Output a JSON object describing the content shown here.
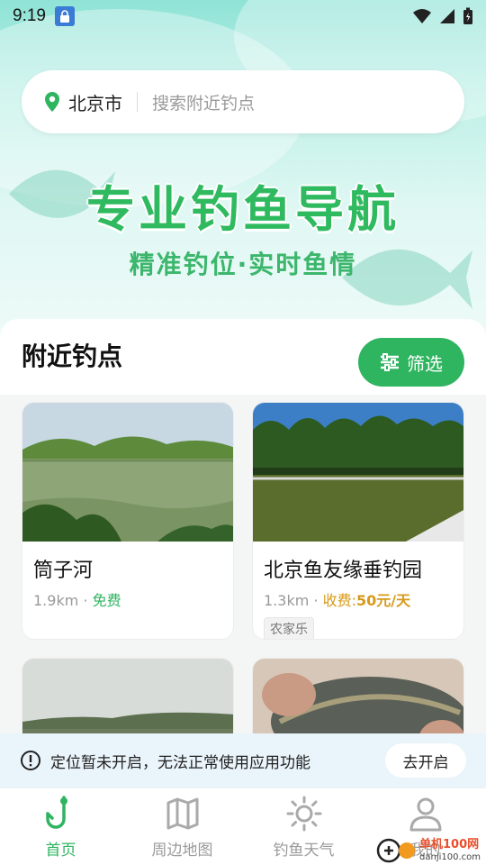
{
  "status": {
    "time": "9:19"
  },
  "search": {
    "city": "北京市",
    "placeholder": "搜索附近钓点"
  },
  "banner": {
    "headline": "专业钓鱼导航",
    "subline": "精准钓位·实时鱼情"
  },
  "section": {
    "title": "附近钓点",
    "filter_label": "筛选"
  },
  "spots": [
    {
      "name": "筒子河",
      "distance": "1.9km",
      "price": "免费",
      "tag": ""
    },
    {
      "name": "北京鱼友缘垂钓园",
      "distance": "1.3km",
      "price_prefix": "收费:",
      "price_value": "50元/天",
      "tag": "农家乐"
    },
    {
      "name": "",
      "distance": "",
      "price": ""
    },
    {
      "name": "",
      "distance": "",
      "price": ""
    }
  ],
  "notice": {
    "text": "定位暂未开启，无法正常使用应用功能",
    "button": "去开启"
  },
  "tabs": [
    {
      "label": "首页",
      "icon": "fishing-hook-icon",
      "active": true
    },
    {
      "label": "周边地图",
      "icon": "map-icon",
      "active": false
    },
    {
      "label": "钓鱼天气",
      "icon": "sun-icon",
      "active": false
    },
    {
      "label": "我的",
      "icon": "user-icon",
      "active": false
    }
  ],
  "watermark": {
    "site": "单机100网",
    "url": "danji100.com"
  },
  "colors": {
    "accent": "#2fb460",
    "fee": "#d79a18",
    "notice_bg": "#eaf4fb"
  }
}
